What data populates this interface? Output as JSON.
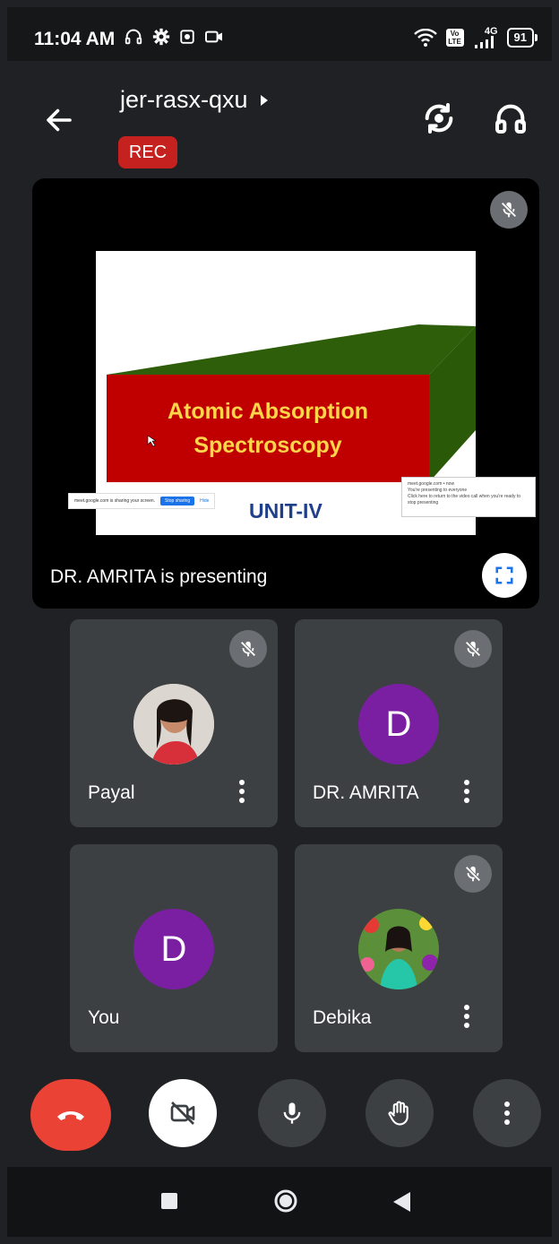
{
  "status_bar": {
    "time": "11:04 AM",
    "network": "4G",
    "volte": "Vo LTE",
    "battery": "91",
    "icons": [
      "headset-icon",
      "settings-icon",
      "screenshot-icon",
      "video-record-icon",
      "wifi-icon",
      "volte-icon",
      "signal-icon",
      "battery-icon"
    ]
  },
  "header": {
    "meeting_code": "jer-rasx-qxu",
    "rec_label": "REC"
  },
  "presentation": {
    "slide": {
      "title_line1": "Atomic Absorption",
      "title_line2": "Spectroscopy",
      "subtitle": "UNIT-IV",
      "share_bar_text": "meet.google.com is sharing your screen.",
      "share_bar_stop": "Stop sharing",
      "share_bar_hide": "Hide",
      "popup_line1": "meet.google.com • now",
      "popup_line2": "You're presenting to everyone",
      "popup_line3": "Click here to return to the video call when you're ready to stop presenting"
    },
    "caption": "DR. AMRITA is presenting",
    "colors": {
      "slide_red": "#c00000",
      "slide_green": "#2e5e0a",
      "slide_title": "#ffd54a",
      "unit_text": "#1f3f8a"
    }
  },
  "participants": [
    {
      "name": "Payal",
      "avatar": "photo",
      "muted": true,
      "has_menu": true
    },
    {
      "name": "DR. AMRITA",
      "avatar": "D",
      "muted": true,
      "has_menu": true
    },
    {
      "name": "You",
      "avatar": "D",
      "muted": false,
      "has_menu": false
    },
    {
      "name": "Debika",
      "avatar": "photo",
      "muted": true,
      "has_menu": true
    }
  ],
  "controls": [
    "end-call-icon",
    "camera-off-icon",
    "microphone-icon",
    "raise-hand-icon",
    "more-options-icon"
  ],
  "nav": [
    "recents-icon",
    "home-icon",
    "back-icon"
  ],
  "colors": {
    "end_call": "#ea4335",
    "avatar_purple": "#7b1fa2",
    "rec": "#c5221f",
    "tile_bg": "#3c4043"
  }
}
